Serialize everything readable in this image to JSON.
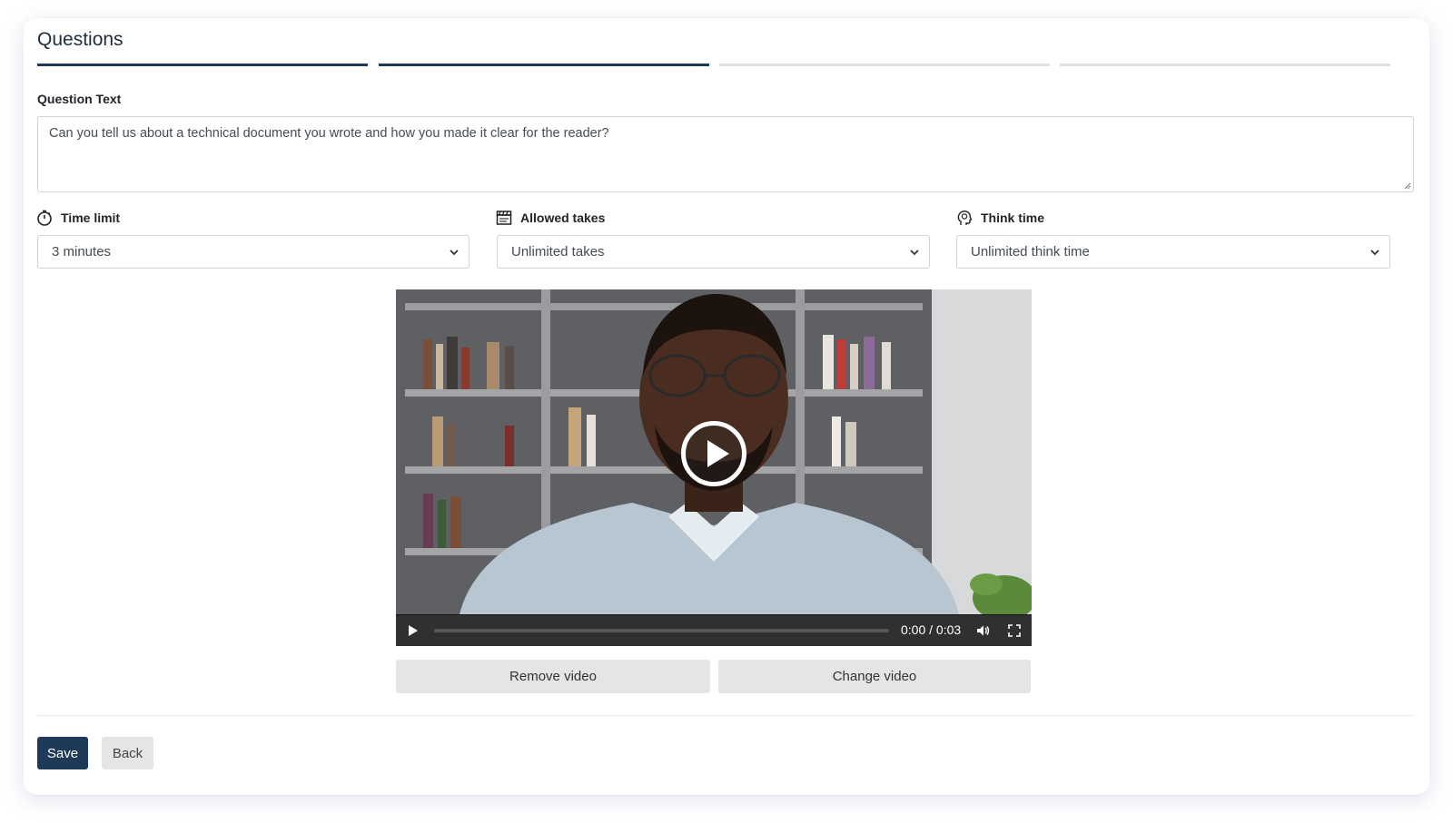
{
  "page": {
    "title": "Questions"
  },
  "steps": [
    {
      "state": "complete"
    },
    {
      "state": "active"
    },
    {
      "state": "upcoming"
    },
    {
      "state": "upcoming"
    }
  ],
  "question": {
    "label": "Question Text",
    "value": "Can you tell us about a technical document you wrote and how you made it clear for the reader?"
  },
  "fields": {
    "time_limit": {
      "label": "Time limit",
      "icon": "stopwatch-icon",
      "value": "3 minutes"
    },
    "allowed_takes": {
      "label": "Allowed takes",
      "icon": "clapperboard-icon",
      "value": "Unlimited takes"
    },
    "think_time": {
      "label": "Think time",
      "icon": "thinking-head-icon",
      "value": "Unlimited think time"
    }
  },
  "video": {
    "current_time": "0:00",
    "duration": "0:03",
    "time_display": "0:00 / 0:03",
    "progress": 0
  },
  "video_actions": {
    "remove_label": "Remove video",
    "change_label": "Change video"
  },
  "footer": {
    "save_label": "Save",
    "back_label": "Back"
  },
  "colors": {
    "primary": "#1e3a58",
    "step_inactive": "#dcdfe3",
    "secondary_button": "#e5e5e5"
  }
}
